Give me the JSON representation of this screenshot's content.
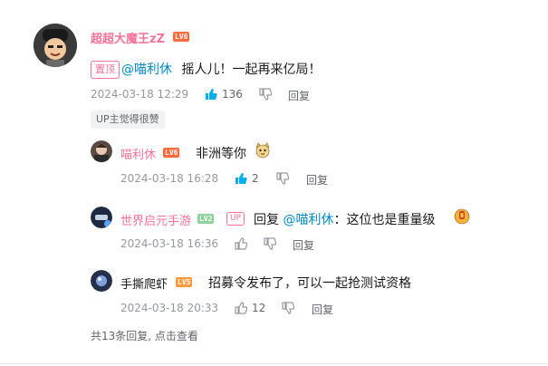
{
  "main_comment": {
    "username": "超超大魔王zZ",
    "level": "LV6",
    "pinned_tag": "置顶",
    "mention": "@喵利休",
    "text": "摇人儿！一起再来亿局！",
    "timestamp": "2024-03-18 12:29",
    "like_count": "136",
    "reply_label": "回复",
    "up_liked_badge": "UP主觉得很赞"
  },
  "replies": [
    {
      "username": "喵利休",
      "level": "LV6",
      "text": "非洲等你",
      "emoji": "cat-emoji",
      "timestamp": "2024-03-18 16:28",
      "like_count": "2",
      "reply_label": "回复"
    },
    {
      "username": "世界启元手游",
      "level": "LV2",
      "up_tag": "UP",
      "reply_prefix": "回复",
      "mention": "@喵利休",
      "text": "：这位也是重量级",
      "emoji": "bow-emoji",
      "timestamp": "2024-03-18 16:36",
      "like_count": "",
      "reply_label": "回复"
    },
    {
      "username": "手撕爬虾",
      "level": "LV5",
      "text": "招募令发布了，可以一起抢测试资格",
      "timestamp": "2024-03-18 20:33",
      "like_count": "12",
      "reply_label": "回复"
    }
  ],
  "view_more": "共13条回复, 点击查看",
  "colors": {
    "username_pink": "#fb7299",
    "lv6": "#ff6a3c",
    "lv5": "#ff9a3c",
    "lv2": "#8bd29b",
    "mention_blue": "#008ac5",
    "like_active_blue": "#00aeec",
    "meta_gray": "#9499a0"
  }
}
